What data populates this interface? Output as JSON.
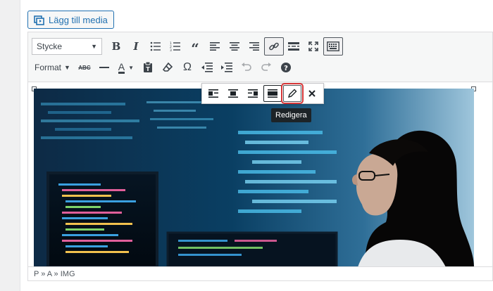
{
  "media_button": {
    "label": "Lägg till media"
  },
  "toolbar": {
    "paragraph_select": {
      "value": "Stycke"
    },
    "format_menu": {
      "label": "Format"
    },
    "strikethrough_label": "ABC"
  },
  "image_toolbar": {
    "tooltip": "Redigera"
  },
  "statusbar": {
    "path": "P » A » IMG"
  },
  "colors": {
    "accent": "#2271b1",
    "highlight": "#d63638",
    "tooltip_bg": "#1d2327"
  }
}
